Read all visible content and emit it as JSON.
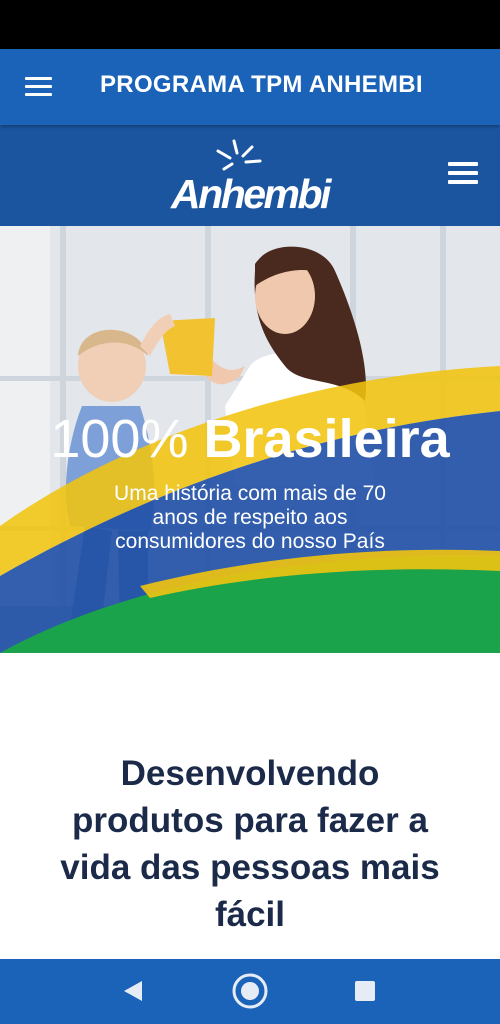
{
  "app_bar": {
    "menu_icon": "hamburger-menu-icon",
    "title": "PROGRAMA TPM ANHEMBI"
  },
  "site_header": {
    "logo_text": "Anhembi",
    "menu_icon": "hamburger-menu-icon"
  },
  "hero": {
    "headline_light": "100%",
    "headline_bold": "Brasileira",
    "subtitle_lines": [
      "Uma história com mais de 70",
      "anos de respeito aos",
      "consumidores do nosso País"
    ]
  },
  "tagline": {
    "lines": [
      "Desenvolvendo",
      "produtos para fazer a",
      "vida das pessoas mais",
      "fácil"
    ]
  },
  "nav_bar": {
    "back_icon": "back-triangle-icon",
    "home_icon": "home-circle-icon",
    "recents_icon": "recents-square-icon"
  },
  "colors": {
    "app_bar": "#1a63b8",
    "site_header": "#1b55a0",
    "tagline_text": "#1c2a4a",
    "flag_yellow": "#f1c40f",
    "flag_green": "#1aa34a",
    "flag_blue": "#1f4fa6"
  }
}
